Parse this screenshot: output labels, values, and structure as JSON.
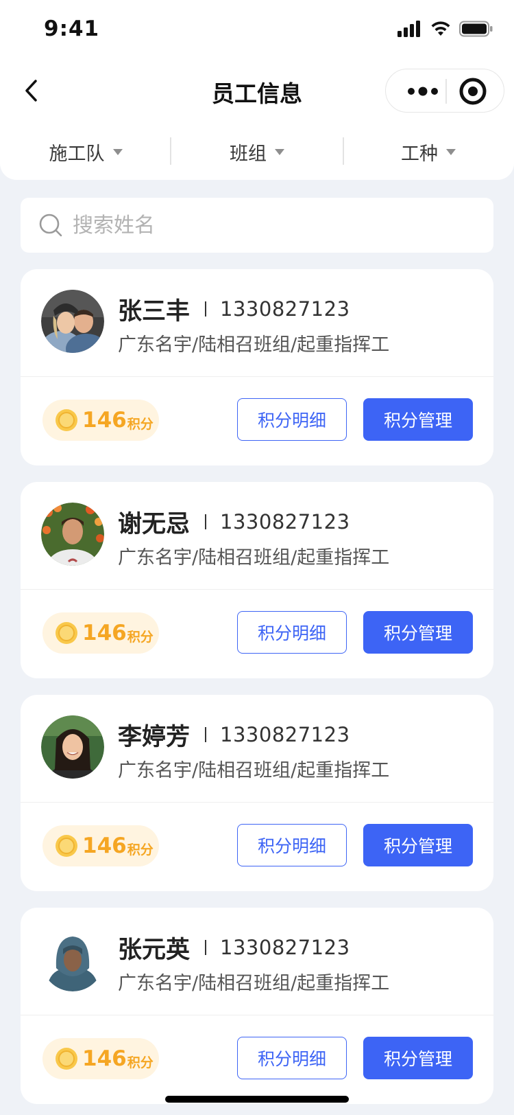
{
  "status_bar": {
    "time": "9:41",
    "icons": [
      "signal-icon",
      "wifi-icon",
      "battery-icon"
    ]
  },
  "nav": {
    "title": "员工信息",
    "back_icon": "chevron-left-icon",
    "more_icon": "more-dots-icon",
    "close_icon": "target-icon"
  },
  "filters": [
    {
      "label": "施工队"
    },
    {
      "label": "班组"
    },
    {
      "label": "工种"
    }
  ],
  "search": {
    "placeholder": "搜索姓名",
    "value": ""
  },
  "colors": {
    "primary": "#3d64f5",
    "points": "#f5a623",
    "points_bg": "#fff4e0",
    "page_bg": "#eff2f7"
  },
  "employees": [
    {
      "name": "张三丰",
      "phone": "1330827123",
      "team": "广东名宇/陆相召班组/起重指挥工",
      "points": "146",
      "points_unit": "积分",
      "detail_label": "积分明细",
      "manage_label": "积分管理"
    },
    {
      "name": "谢无忌",
      "phone": "1330827123",
      "team": "广东名宇/陆相召班组/起重指挥工",
      "points": "146",
      "points_unit": "积分",
      "detail_label": "积分明细",
      "manage_label": "积分管理"
    },
    {
      "name": "李婷芳",
      "phone": "1330827123",
      "team": "广东名宇/陆相召班组/起重指挥工",
      "points": "146",
      "points_unit": "积分",
      "detail_label": "积分明细",
      "manage_label": "积分管理"
    },
    {
      "name": "张元英",
      "phone": "1330827123",
      "team": "广东名宇/陆相召班组/起重指挥工",
      "points": "146",
      "points_unit": "积分",
      "detail_label": "积分明细",
      "manage_label": "积分管理"
    }
  ]
}
